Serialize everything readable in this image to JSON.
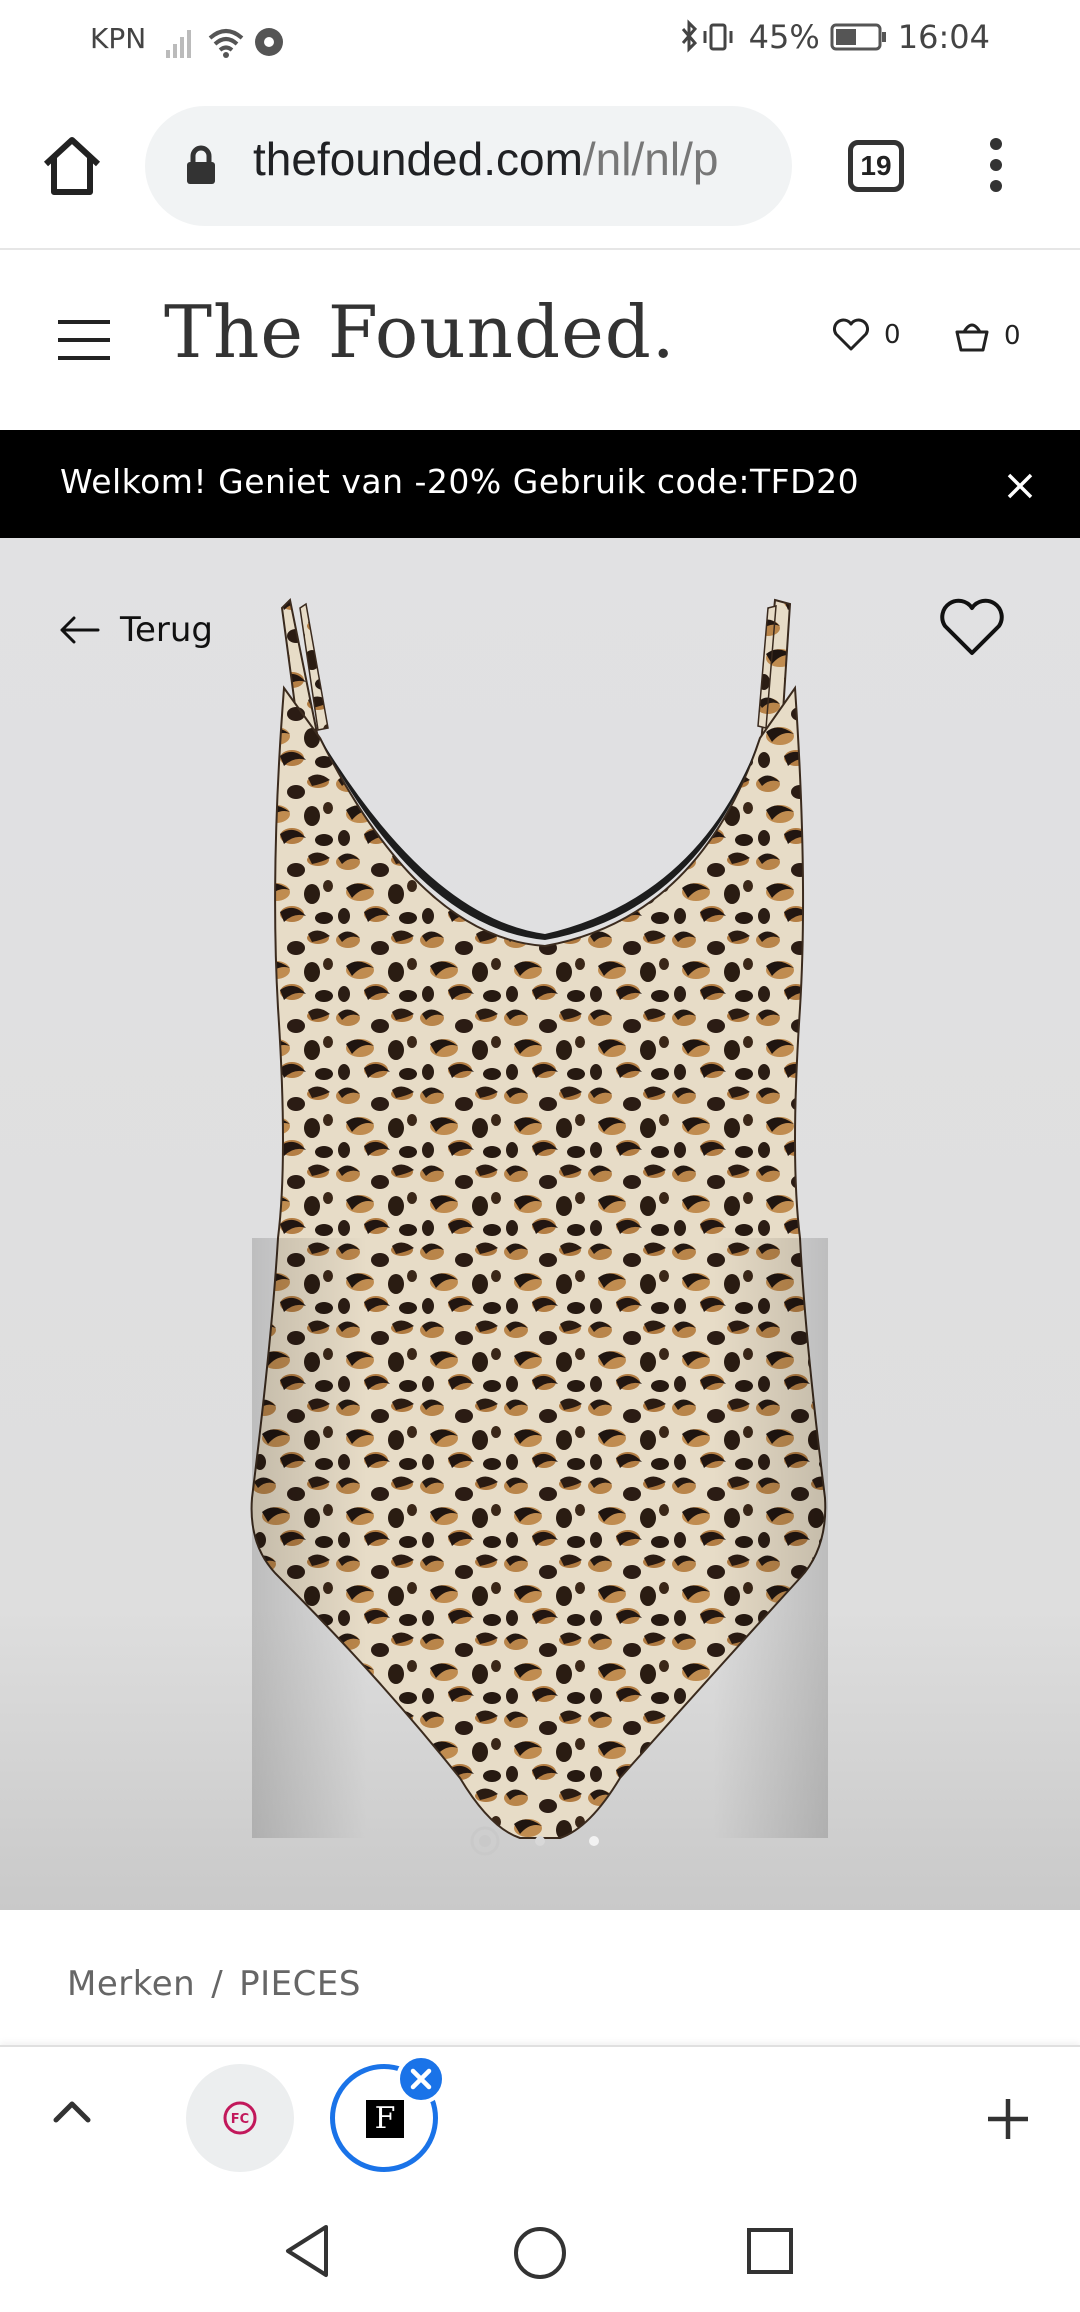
{
  "status_bar": {
    "carrier": "KPN",
    "battery": "45%",
    "time": "16:04"
  },
  "browser": {
    "url_host": "thefounded.com",
    "url_path": "/nl/nl/p",
    "tab_count": "19"
  },
  "site": {
    "logo": "The Founded.",
    "wishlist_count": "0",
    "cart_count": "0"
  },
  "promo": {
    "text": "Welkom! Geniet van -20% Gebruik code:TFD20"
  },
  "product": {
    "back_label": "Terug",
    "image_index": 1,
    "image_count": 3
  },
  "breadcrumb": {
    "root": "Merken",
    "separator": "/",
    "current": "PIECES"
  },
  "tab_strip": {
    "tab1_favicon_text": "FC",
    "tab2_favicon_text": "F"
  },
  "colors": {
    "accent_blue": "#1a73e8",
    "promo_bg": "#000000",
    "product_bg": "#e1e1e3"
  }
}
